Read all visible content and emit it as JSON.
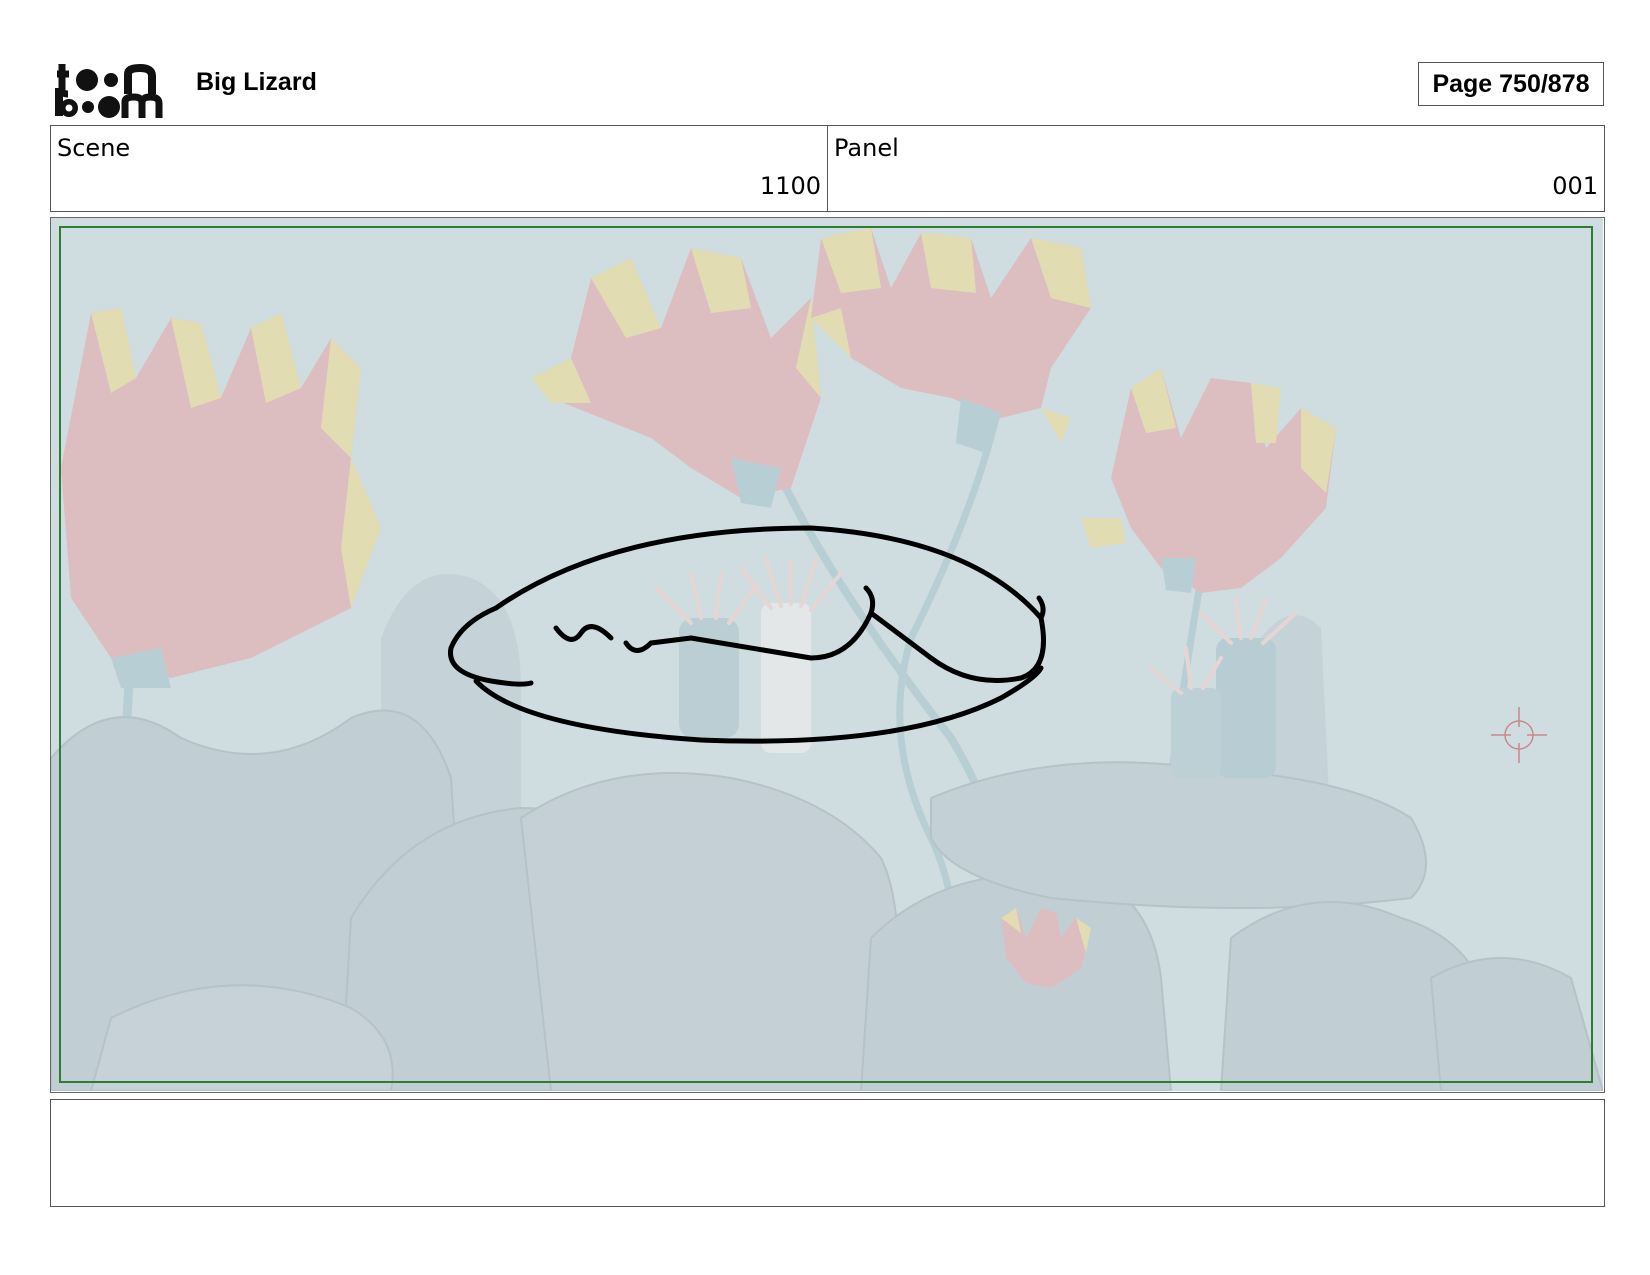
{
  "header": {
    "logo": {
      "line1": "toon",
      "line2": "boom"
    },
    "project_title": "Big Lizard",
    "page_label": "Page 750/878"
  },
  "info": {
    "scene_label": "Scene",
    "scene_value": "1100",
    "panel_label": "Panel",
    "panel_value": "001"
  },
  "panel": {
    "background": "underwater coral reef scene",
    "colors": {
      "water": "#c9d8dc",
      "rock": "#b6c4ca",
      "frond_pink": "#dcaeb0",
      "frond_yellow": "#e3d79c",
      "stem": "#a9c4cc",
      "safe_frame": "#2e7d32",
      "sketch": "#000000"
    },
    "icons": [
      "crosshair-icon"
    ]
  },
  "notes": {
    "text": ""
  }
}
